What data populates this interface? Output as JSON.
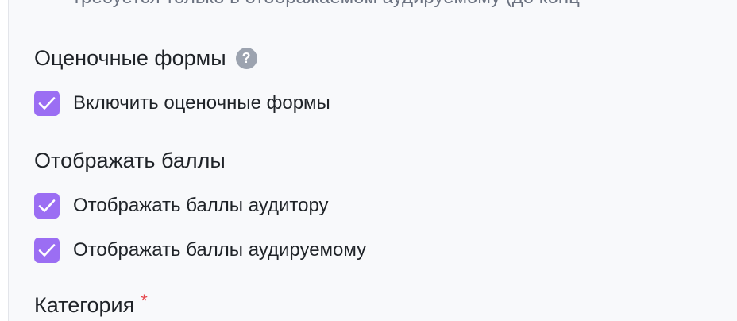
{
  "truncated_top_text": "требуется только в отображаемом аудируемому (до конц",
  "sections": {
    "forms": {
      "title": "Оценочные формы",
      "enable_label": "Включить оценочные формы",
      "enable_checked": true
    },
    "scores": {
      "title": "Отображать баллы",
      "auditor_label": "Отображать баллы аудитору",
      "auditor_checked": true,
      "auditee_label": "Отображать баллы аудируемому",
      "auditee_checked": true
    },
    "category": {
      "title": "Категория",
      "required_mark": "*"
    }
  },
  "colors": {
    "accent": "#9b6ef3",
    "required": "#e5484d",
    "help_icon": "#9ca3af"
  }
}
